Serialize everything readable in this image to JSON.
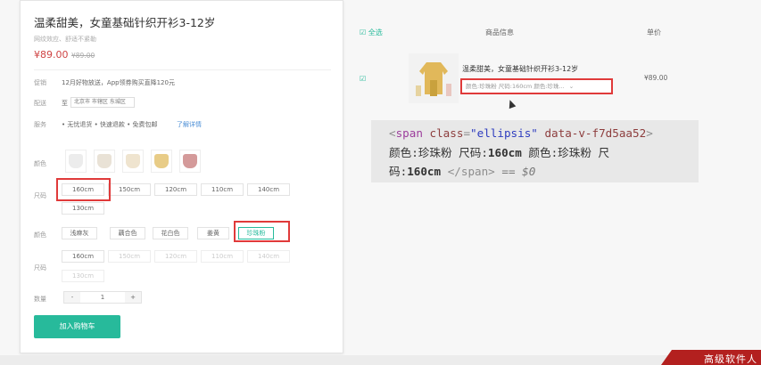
{
  "product": {
    "title": "温柔甜美，女童基础针织开衫3-12岁",
    "subtitle": "网纹效应、舒适不紧勒",
    "price": "¥89.00",
    "old_price": "¥89.00",
    "promo_label": "促销",
    "promo_text": "12月好物放送，App领券购买直降120元",
    "delivery_label": "配送",
    "delivery_to": "至",
    "address": "北京市 市辖区 东城区",
    "service_label": "服务",
    "services": "• 无忧退货  • 快速退款  • 免费包邮",
    "service_link": "了解详情",
    "color_label": "颜色",
    "size_label": "尺码",
    "color2_label": "颜色",
    "size2_label": "尺码",
    "sizes": [
      "160cm",
      "150cm",
      "120cm",
      "110cm",
      "140cm",
      "130cm"
    ],
    "colors_text": [
      "浅麻灰",
      "藕合色",
      "花白色",
      "姜黄",
      "珍珠粉"
    ],
    "sizes2": [
      "160cm",
      "150cm",
      "120cm",
      "110cm",
      "140cm",
      "130cm"
    ],
    "qty_label": "数量",
    "qty_minus": "-",
    "qty_value": "1",
    "qty_plus": "+",
    "add_to_cart": "加入购物车"
  },
  "cart": {
    "select_all": "全选",
    "col_info": "商品信息",
    "col_price": "单价",
    "item_name": "温柔甜美，女童基础针织开衫3-12岁",
    "item_attrs": "颜色:珍珠粉 尺码:160cm 颜色:珍珠...",
    "item_price": "¥89.00"
  },
  "devtools": {
    "l1_open": "<",
    "l1_tag": "span",
    "l1_attr1": " class",
    "l1_eq1": "=",
    "l1_val1": "\"ellipsis\"",
    "l1_attr2": " data-v-f7d5aa52",
    "l1_close": ">",
    "l2_text_a": "颜色:珍珠粉 尺码:",
    "l2_text_b": "160cm",
    "l2_text_c": " 颜色:珍珠粉 尺",
    "l3_text_a": "码:",
    "l3_text_b": "160cm",
    "l3_close": " </span>",
    "l3_eq": " == ",
    "l3_var": "$0"
  },
  "watermark": "高级软件人",
  "colors": {
    "accent": "#27ba9b",
    "price": "#cf4444",
    "highlight_box": "#e03a3a",
    "watermark_bg": "#b3201f"
  }
}
